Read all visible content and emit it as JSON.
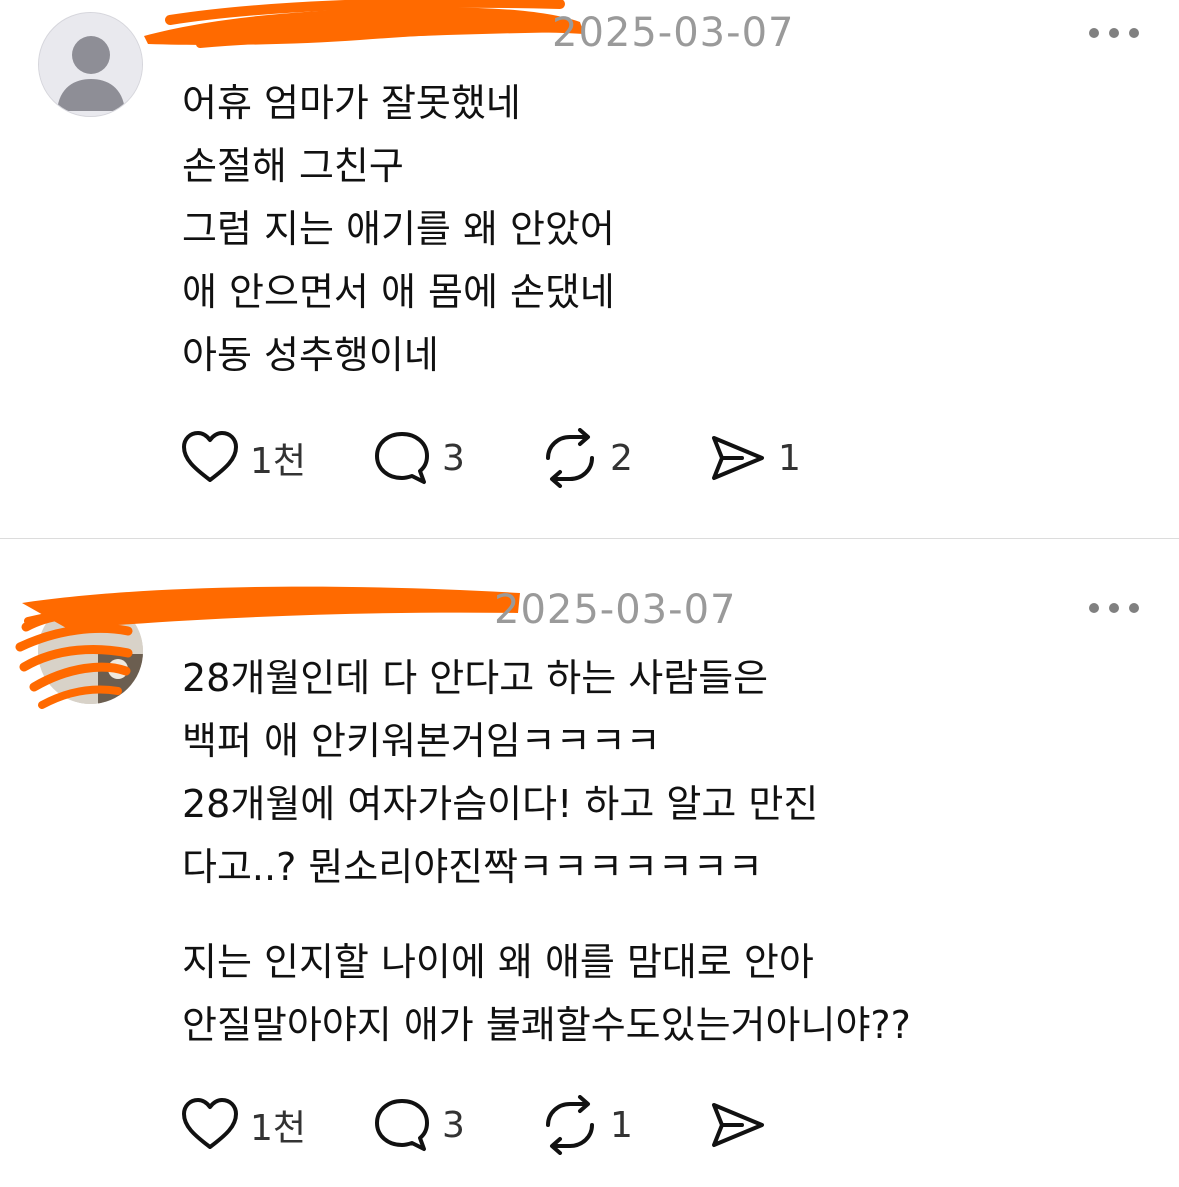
{
  "posts": [
    {
      "date": "2025-03-07",
      "lines": [
        "어휴 엄마가 잘못했네",
        "손절해 그친구",
        "그럼 지는 애기를 왜 안았어",
        "애 안으면서 애 몸에 손댔네",
        "아동 성추행이네"
      ],
      "actions": {
        "like_count": "1천",
        "reply_count": "3",
        "repost_count": "2",
        "share_count": "1"
      }
    },
    {
      "date": "2025-03-07",
      "lines": [
        "28개월인데 다 안다고 하는 사람들은",
        "백퍼 애 안키워본거임ㅋㅋㅋㅋ",
        "28개월에 여자가슴이다! 하고 알고 만진",
        "다고..? 뭔소리야진짝ㅋㅋㅋㅋㅋㅋㅋ"
      ],
      "lines_2": [
        "지는 인지할 나이에 왜 애를 맘대로 안아",
        "안질말아야지 애가 불쾌할수도있는거아니야??"
      ],
      "actions": {
        "like_count": "1천",
        "reply_count": "3",
        "repost_count": "1",
        "share_count": ""
      }
    }
  ],
  "colors": {
    "redaction": "#ff6a00",
    "timestamp": "#9a9a9a",
    "icon": "#111111",
    "divider": "#dcdcdc"
  },
  "icons": [
    "default-avatar-icon",
    "more-dots-icon",
    "heart-icon",
    "reply-bubble-icon",
    "repost-icon",
    "share-send-icon"
  ]
}
